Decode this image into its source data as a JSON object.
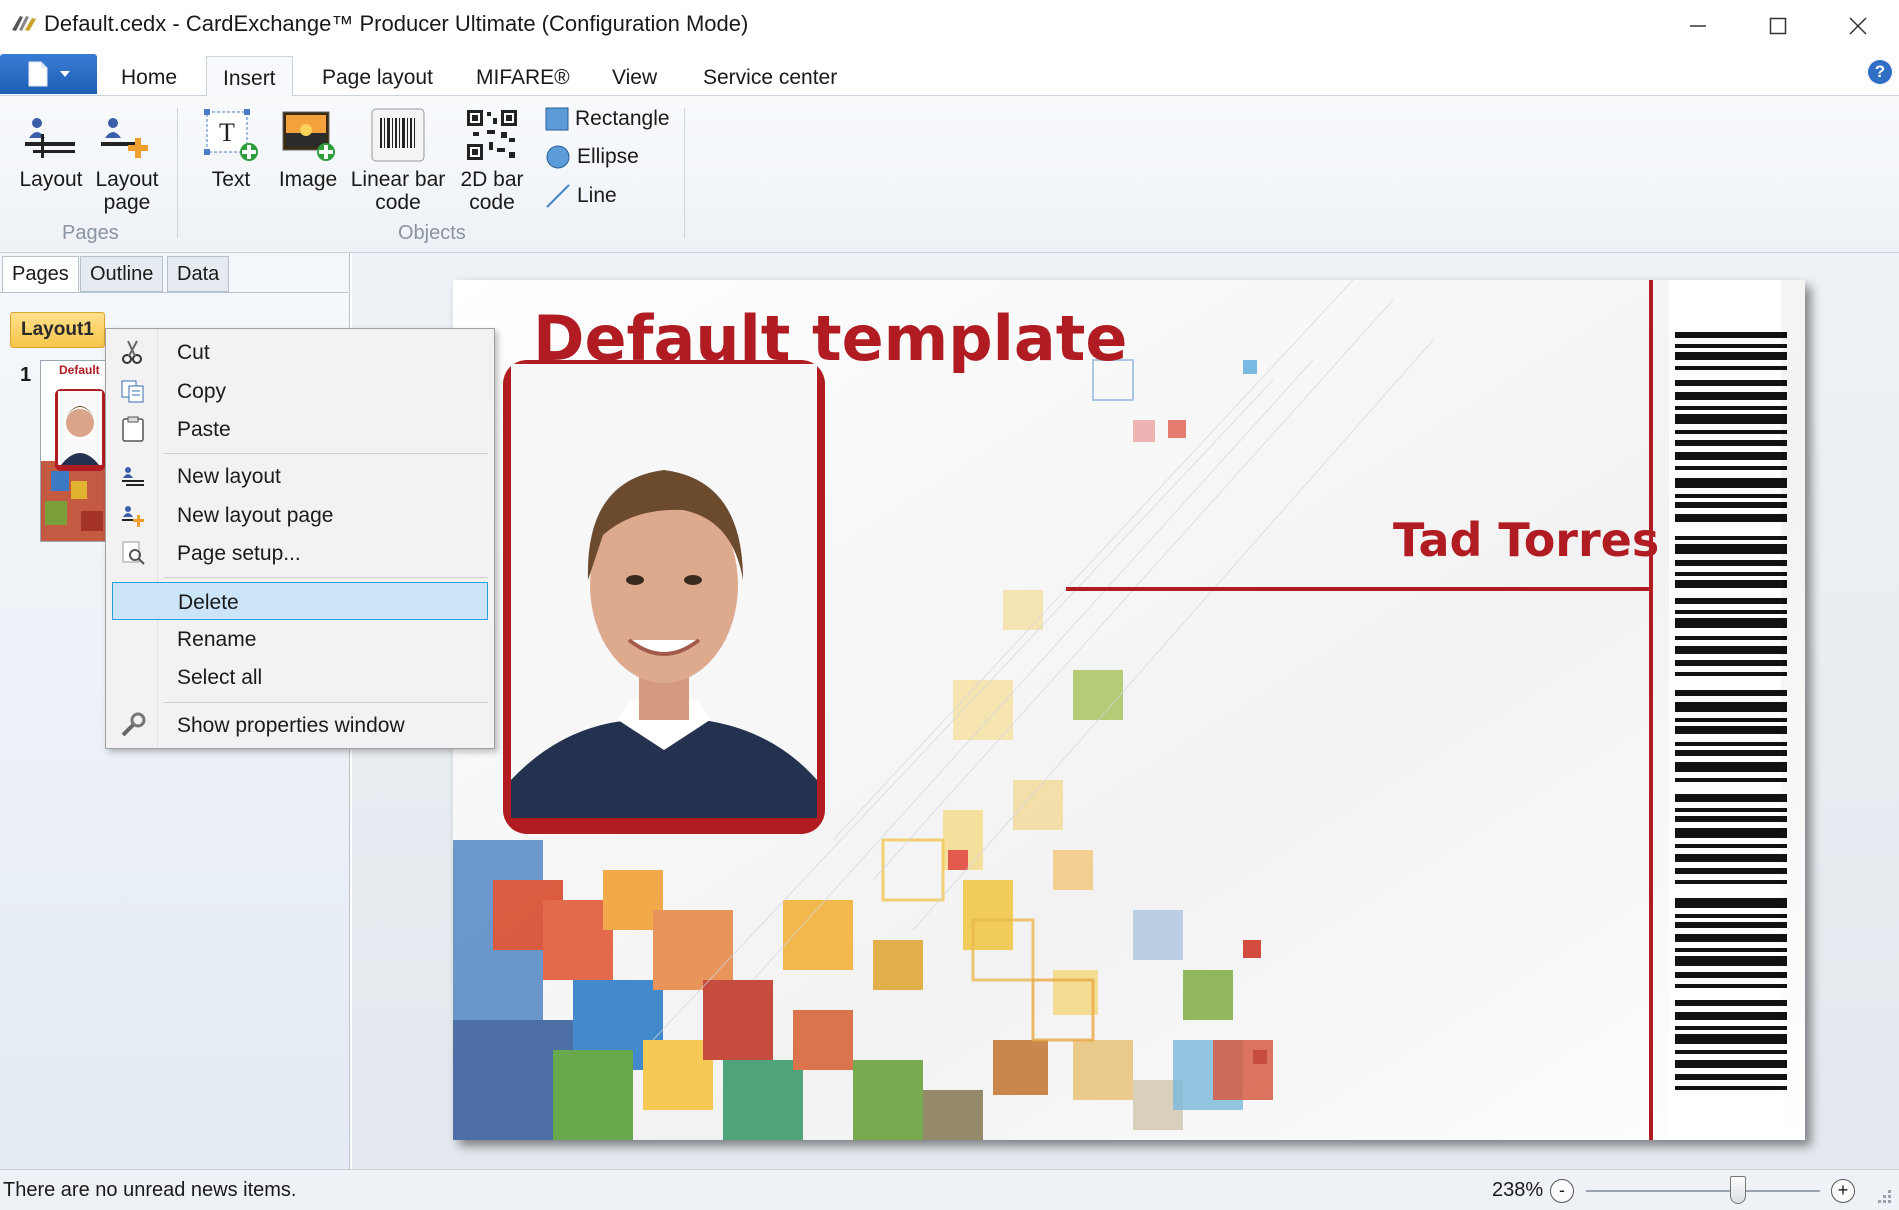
{
  "window": {
    "title": "Default.cedx - CardExchange™ Producer Ultimate (Configuration Mode)",
    "minimize": "—",
    "maximize": "☐",
    "close": "✕"
  },
  "ribbon": {
    "tabs": [
      {
        "label": "Home"
      },
      {
        "label": "Insert",
        "active": true
      },
      {
        "label": "Page layout"
      },
      {
        "label": "MIFARE®"
      },
      {
        "label": "View"
      },
      {
        "label": "Service center"
      }
    ],
    "help": "?",
    "groups": {
      "pages": {
        "label": "Pages",
        "layout": "Layout",
        "layout_page_1": "Layout",
        "layout_page_2": "page"
      },
      "objects": {
        "label": "Objects",
        "text": "Text",
        "image": "Image",
        "linear_1": "Linear bar",
        "linear_2": "code",
        "barcode2d_1": "2D bar",
        "barcode2d_2": "code",
        "rectangle": "Rectangle",
        "ellipse": "Ellipse",
        "line": "Line"
      }
    }
  },
  "panel": {
    "tabs": [
      "Pages",
      "Outline",
      "Data"
    ],
    "layout_name": "Layout1",
    "page_number": "1",
    "thumb_title": "Default"
  },
  "card": {
    "title": "Default template",
    "name": "Tad Torres",
    "accent": "#b01c22"
  },
  "context_menu": {
    "items": [
      {
        "label": "Cut",
        "icon": "scissors-icon"
      },
      {
        "label": "Copy",
        "icon": "copy-icon"
      },
      {
        "label": "Paste",
        "icon": "paste-icon"
      },
      {
        "label": "New layout",
        "icon": "new-layout-icon"
      },
      {
        "label": "New layout page",
        "icon": "new-layout-page-icon"
      },
      {
        "label": "Page setup...",
        "icon": "page-setup-icon"
      },
      {
        "label": "Delete",
        "highlighted": true
      },
      {
        "label": "Rename"
      },
      {
        "label": "Select all"
      },
      {
        "label": "Show properties window",
        "icon": "wrench-icon"
      }
    ]
  },
  "status": {
    "message": "There are no unread news items.",
    "zoom": "238%",
    "zoom_out": "-",
    "zoom_in": "+",
    "zoom_fraction": 0.65
  }
}
